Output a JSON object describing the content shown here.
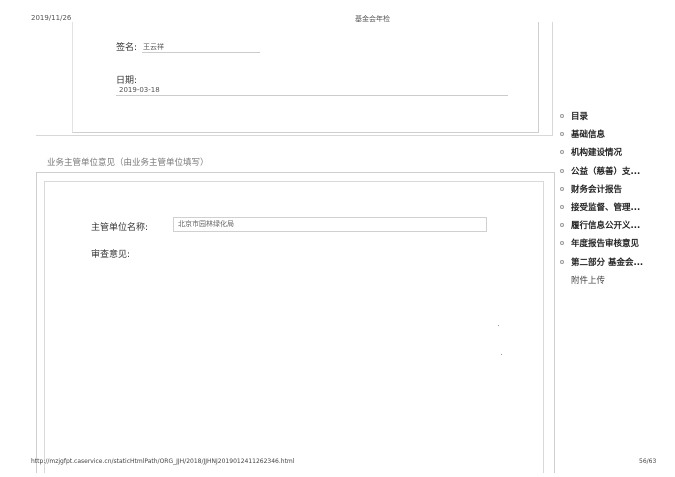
{
  "header": {
    "date": "2019/11/26",
    "title": "基金会年检"
  },
  "signature": {
    "label": "签名:",
    "value": "王云祥"
  },
  "date_field": {
    "label": "日期:",
    "value": "2019-03-18"
  },
  "section": {
    "title": "业务主管单位意见（由业务主管单位填写）"
  },
  "authority": {
    "label": "主管单位名称:",
    "value": "北京市园林绿化局"
  },
  "review": {
    "label": "审查意见:"
  },
  "nav": {
    "items": [
      {
        "label": "目录"
      },
      {
        "label": "基础信息"
      },
      {
        "label": "机构建设情况"
      },
      {
        "label": "公益（慈善）支..."
      },
      {
        "label": "财务会计报告"
      },
      {
        "label": "接受监督、管理..."
      },
      {
        "label": "履行信息公开义..."
      },
      {
        "label": "年度报告审核意见"
      },
      {
        "label": "第二部分 基金会..."
      },
      {
        "label": "附件上传"
      }
    ]
  },
  "footer": {
    "url": "http://mzjgfpt.caservice.cn/staticHtmlPath/ORG_JJH/2018/JJHNJ2019012411262346.html",
    "page": "56/63"
  }
}
